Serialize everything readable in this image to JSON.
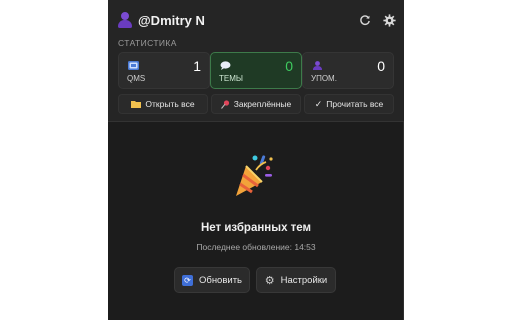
{
  "header": {
    "username": "@Dmitry N",
    "icons": {
      "user": "user-icon",
      "refresh": "refresh-icon",
      "settings": "gear-icon"
    }
  },
  "stats": {
    "section_title": "СТАТИСТИКА",
    "cards": [
      {
        "label": "QMS",
        "value": "1",
        "icon": "qms-icon",
        "active": false
      },
      {
        "label": "ТЕМЫ",
        "value": "0",
        "icon": "chat-bubble-icon",
        "active": true
      },
      {
        "label": "УПОМ.",
        "value": "0",
        "icon": "mention-user-icon",
        "active": false
      }
    ]
  },
  "actions": {
    "open_all": "Открыть все",
    "pinned": "Закреплённые",
    "read_all": "Прочитать все"
  },
  "empty_state": {
    "icon": "party-popper-icon",
    "title": "Нет избранных тем",
    "subtitle": "Последнее обновление: 14:53"
  },
  "buttons": {
    "update": "Обновить",
    "settings": "Настройки"
  },
  "colors": {
    "panel_bg": "#1c1c1c",
    "top_bg": "#252525",
    "accent_green": "#3ecb5f",
    "active_card_bg": "#1f3a25",
    "user_purple": "#7b4bd1",
    "update_blue": "#3f6fd8"
  }
}
